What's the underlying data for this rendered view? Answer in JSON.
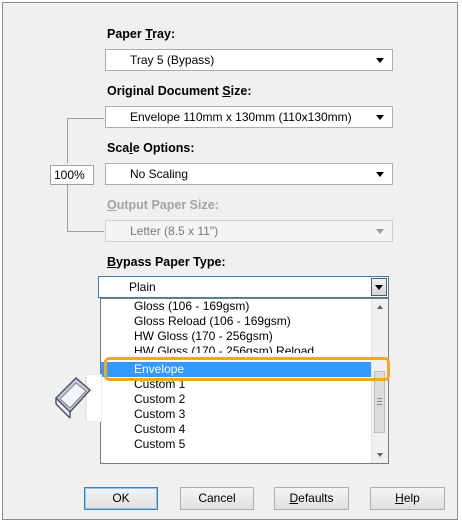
{
  "paper_tray": {
    "label_pre": "Paper ",
    "label_key": "T",
    "label_post": "ray:",
    "value": "Tray 5 (Bypass)"
  },
  "original_size": {
    "label_pre": "Original Document ",
    "label_key": "S",
    "label_post": "ize:",
    "value": "Envelope 110mm x 130mm (110x130mm)"
  },
  "scale_options": {
    "label_pre": "Sca",
    "label_key": "l",
    "label_post": "e Options:",
    "value": "No Scaling",
    "percent": "100%"
  },
  "output_size": {
    "label_pre": "",
    "label_key": "O",
    "label_post": "utput Paper Size:",
    "value": "Letter (8.5 x 11\")"
  },
  "bypass_type": {
    "label_pre": "",
    "label_key": "B",
    "label_post": "ypass Paper Type:",
    "value": "Plain"
  },
  "dropdown_options": [
    "Gloss (106 - 169gsm)",
    "Gloss Reload (106 - 169gsm)",
    "HW Gloss (170 - 256gsm)",
    "HW Gloss (170 - 256gsm) Reload",
    "Envelope",
    "Custom 1",
    "Custom 2",
    "Custom 3",
    "Custom 4",
    "Custom 5"
  ],
  "selected_option": "Envelope",
  "buttons": {
    "ok": "OK",
    "cancel": "Cancel",
    "defaults_key": "D",
    "defaults_rest": "efaults",
    "help_key": "H",
    "help_rest": "elp"
  },
  "colors": {
    "selection": "#3399ff",
    "highlight": "#f5a623",
    "default_button_border": "#3c7fb1"
  }
}
